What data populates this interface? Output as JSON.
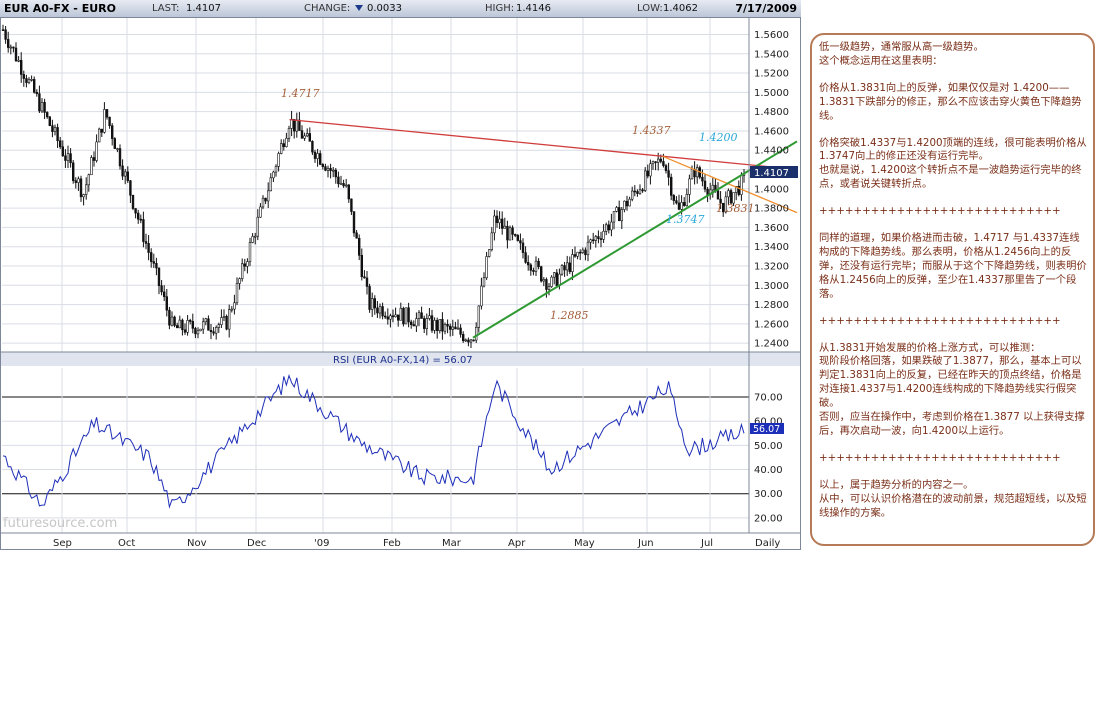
{
  "header": {
    "symbol": "EUR A0-FX - EURO",
    "last_label": "LAST:",
    "last_value": "1.4107",
    "change_label": "CHANGE:",
    "change_value": "0.0033",
    "high_label": "HIGH:",
    "high_value": "1.4146",
    "low_label": "LOW:",
    "low_value": "1.4062",
    "date": "7/17/2009"
  },
  "watermark": "futuresource.com",
  "price_box": "1.4107",
  "rsi_box": "56.07",
  "rsi_title": "RSI (EUR A0-FX,14) = 56.07",
  "annotations": {
    "high": "1.4717",
    "mid_high": "1.4337",
    "top_1": "1.4200",
    "swing_low": "1.3747",
    "recent_low": "1.3831",
    "bottom": "1.2885"
  },
  "notes": [
    "低一级趋势，通常服从高一级趋势。",
    "这个概念运用在这里表明：",
    "",
    "价格从1.3831向上的反弹，如果仅仅是对 1.4200——1.3831下跌部分的修正，那么不应该击穿火黄色下降趋势线。",
    "",
    "价格突破1.4337与1.4200顶端的连线，很可能表明价格从1.3747向上的修正还没有运行完毕。",
    "也就是说，1.4200这个转折点不是一波趋势运行完毕的终点，或者说关键转折点。",
    "",
    "++++++++++++++++++++++++++++",
    "",
    "同样的道理，如果价格进而击破，1.4717 与1.4337连线构成的下降趋势线。那么表明，价格从1.2456向上的反弹，还没有运行完毕；而服从于这个下降趋势线，则表明价格从1.2456向上的反弹，至少在1.4337那里告了一个段落。",
    "",
    "++++++++++++++++++++++++++++",
    "",
    "从1.3831开始发展的价格上涨方式，可以推测：",
    "现阶段价格回落，如果跌破了1.3877，那么，基本上可以判定1.3831向上的反复，已经在昨天的顶点终结，价格是对连接1.4337与1.4200连线构成的下降趋势线实行假突破。",
    "否则，应当在操作中，考虑到价格在1.3877 以上获得支撑后，再次启动一波，向1.4200以上运行。",
    "",
    "++++++++++++++++++++++++++++",
    "",
    "以上，属于趋势分析的内容之一。",
    "从中，可以认识价格潜在的波动前景，规范超短线，以及短线操作的方案。"
  ],
  "colors": {
    "candle": "#111111",
    "trend_red": "#d13c3c",
    "trend_orange": "#f09030",
    "trend_green": "#2f9a33",
    "rsi_line": "#1e2fb8",
    "annot_brown": "#a5603a",
    "annot_cyan": "#2aa8d8",
    "price_box_bg": "#1b2f6b"
  },
  "chart_data": [
    {
      "type": "candlestick",
      "title": "EUR A0-FX - EURO",
      "xlabel": "",
      "ylabel": "",
      "x_ticks": [
        "Sep",
        "Oct",
        "Nov",
        "Dec",
        "'09",
        "Feb",
        "Mar",
        "Apr",
        "May",
        "Jun",
        "Jul",
        "Daily"
      ],
      "y_ticks": [
        "1.2400",
        "1.2600",
        "1.2800",
        "1.3000",
        "1.3200",
        "1.3400",
        "1.3600",
        "1.3800",
        "1.4000",
        "1.4200",
        "1.4400",
        "1.4600",
        "1.4800",
        "1.5000",
        "1.5200",
        "1.5400",
        "1.5600"
      ],
      "ylim": [
        1.235,
        1.575
      ],
      "key_points": [
        {
          "date": "Aug-2008",
          "price": 1.565
        },
        {
          "date": "Sep-2008",
          "price": 1.395
        },
        {
          "date": "Sep-2008",
          "price": 1.48
        },
        {
          "date": "Oct-2008",
          "price": 1.33
        },
        {
          "date": "Oct-2008",
          "price": 1.255
        },
        {
          "date": "Nov-2008",
          "price": 1.26
        },
        {
          "date": "Dec-2008",
          "price": 1.4717
        },
        {
          "date": "Jan-2009",
          "price": 1.4
        },
        {
          "date": "Jan-2009",
          "price": 1.28
        },
        {
          "date": "Mar-2009",
          "price": 1.2456
        },
        {
          "date": "Mar-2009",
          "price": 1.37
        },
        {
          "date": "Apr-2009",
          "price": 1.3
        },
        {
          "date": "May-2009",
          "price": 1.37
        },
        {
          "date": "Jun-2009",
          "price": 1.4337
        },
        {
          "date": "Jun-2009",
          "price": 1.3747
        },
        {
          "date": "Jun-2009",
          "price": 1.42
        },
        {
          "date": "Jul-2009",
          "price": 1.3831
        },
        {
          "date": "Jul-2009",
          "price": 1.4107
        }
      ],
      "trendlines": [
        {
          "color": "red",
          "from": 1.4717,
          "to": 1.4337
        },
        {
          "color": "orange",
          "from": 1.4337,
          "to": 1.42
        },
        {
          "color": "green",
          "from": 1.2456,
          "to": 1.3747
        }
      ]
    },
    {
      "type": "line",
      "title": "RSI (EUR A0-FX,14) = 56.07",
      "y_ticks": [
        "20.00",
        "30.00",
        "40.00",
        "50.00",
        "60.00",
        "70.00"
      ],
      "ylim": [
        15,
        82
      ],
      "reference_lines": [
        30,
        70
      ],
      "key_points": [
        {
          "date": "Aug-2008",
          "value": 46
        },
        {
          "date": "Aug-2008",
          "value": 25
        },
        {
          "date": "Sep-2008",
          "value": 59
        },
        {
          "date": "Oct-2008",
          "value": 45
        },
        {
          "date": "Oct-2008",
          "value": 24
        },
        {
          "date": "Dec-2008",
          "value": 78
        },
        {
          "date": "Jan-2009",
          "value": 52
        },
        {
          "date": "Feb-2009",
          "value": 37
        },
        {
          "date": "Mar-2009",
          "value": 36
        },
        {
          "date": "Mar-2009",
          "value": 76
        },
        {
          "date": "Apr-2009",
          "value": 40
        },
        {
          "date": "Jun-2009",
          "value": 74
        },
        {
          "date": "Jun-2009",
          "value": 48
        },
        {
          "date": "Jul-2009",
          "value": 56.07
        }
      ]
    }
  ]
}
